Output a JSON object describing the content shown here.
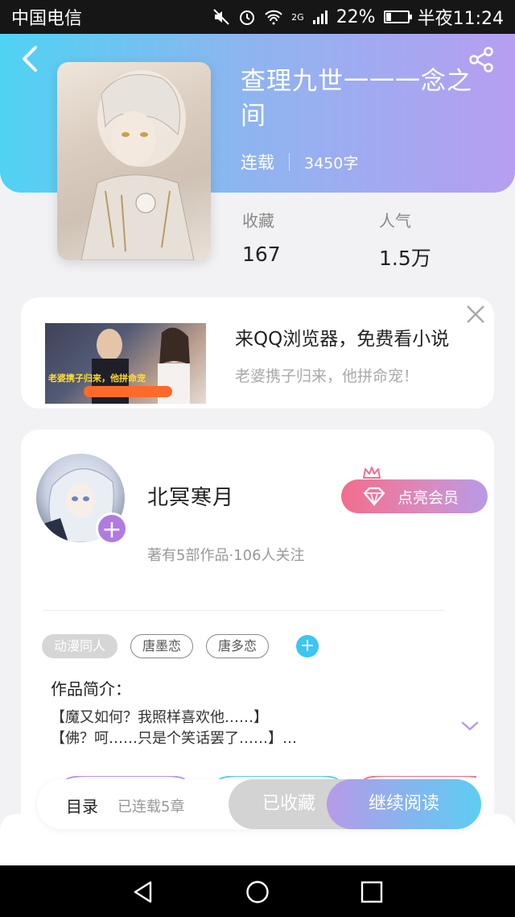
{
  "status_bar": {
    "carrier": "中国电信",
    "network": "2G",
    "battery": "22%",
    "battery_level": 0.22,
    "time": "半夜11:24"
  },
  "book": {
    "title": "查理九世一一一念之间",
    "status": "连载",
    "word_count": "3450字",
    "stats": [
      {
        "label": "收藏",
        "value": "167"
      },
      {
        "label": "人气",
        "value": "1.5万"
      }
    ]
  },
  "ad": {
    "title": "来QQ浏览器，免费看小说",
    "subtitle": "老婆携子归来，他拼命宠！",
    "image_caption": "老婆携子归来，他拼命宠"
  },
  "author": {
    "name": "北冥寒月",
    "stats": "著有5部作品·106人关注",
    "vip_label": "点亮会员"
  },
  "tags": [
    "动漫同人",
    "唐墨恋",
    "唐多恋"
  ],
  "intro": {
    "label": "作品简介：",
    "lines": [
      "【魔又如何？我照样喜欢他……】",
      "【佛？呵……只是个笑话罢了……】…"
    ]
  },
  "action_bar": {
    "toc": "目录",
    "serial": "已连载5章",
    "collected": "已收藏",
    "read": "继续阅读"
  },
  "colors": {
    "accent_blue": "#4fd3f2",
    "accent_purple": "#b79ef0",
    "vip_pink": "#f26d8e"
  }
}
